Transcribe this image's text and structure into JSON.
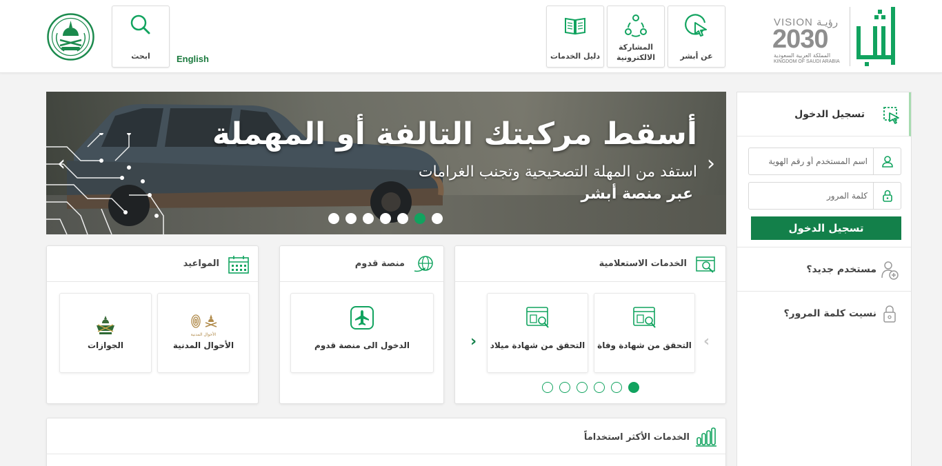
{
  "colors": {
    "brand_green": "#13804a",
    "accent_green": "#11a35f",
    "text_dark": "#333333"
  },
  "header": {
    "nav": [
      {
        "label": "عن أبشر",
        "icon": "cursor-click-icon"
      },
      {
        "label": "المشاركة الالكترونية",
        "icon": "people-network-icon"
      },
      {
        "label": "دليل الخدمات",
        "icon": "book-icon"
      }
    ],
    "english_link": "English",
    "search": {
      "label": "ابحث",
      "icon": "search-icon"
    },
    "vision": {
      "top": "VISION رؤيـة",
      "number": "2030",
      "line1": "المملكة العربية السعودية",
      "line2": "KINGDOM OF SAUDI ARABIA"
    }
  },
  "banner": {
    "title": "أسقط مركبتك التالفة أو المهملة",
    "subtitle": "استفد من المهلة التصحيحية وتجنب الغرامات",
    "subtitle2": "عبر منصة أبشر",
    "slides_total": 7,
    "active_slide": 6,
    "prev_arrow": "‹",
    "next_arrow": "›"
  },
  "login": {
    "title": "تسجيل الدخول",
    "username_placeholder": "اسم المستخدم أو رقم الهوية",
    "password_placeholder": "كلمة المرور",
    "button": "تسجيل الدخول",
    "new_user": "مستخدم جديد؟",
    "forgot_password": "نسيت كلمة المرور؟"
  },
  "inquiry": {
    "title": "الخدمات الاستعلامية",
    "tiles": [
      {
        "label": "التحقق من شهادة وفاة"
      },
      {
        "label": "التحقق من شهادة ميلاد"
      }
    ],
    "prev": "‹",
    "next": "‹",
    "dots_total": 6,
    "active_dot": 1
  },
  "qudoom": {
    "title": "منصة قدوم",
    "tile": "الدخول الى منصة قدوم"
  },
  "appointments": {
    "title": "المواعيد",
    "tiles": [
      {
        "label": "الأحوال المدنية",
        "logo_text": "الأحوال المدنية"
      },
      {
        "label": "الجوازات",
        "logo_text": ""
      }
    ]
  },
  "most_used": {
    "title": "الخدمات الأكثر استخداماً"
  }
}
